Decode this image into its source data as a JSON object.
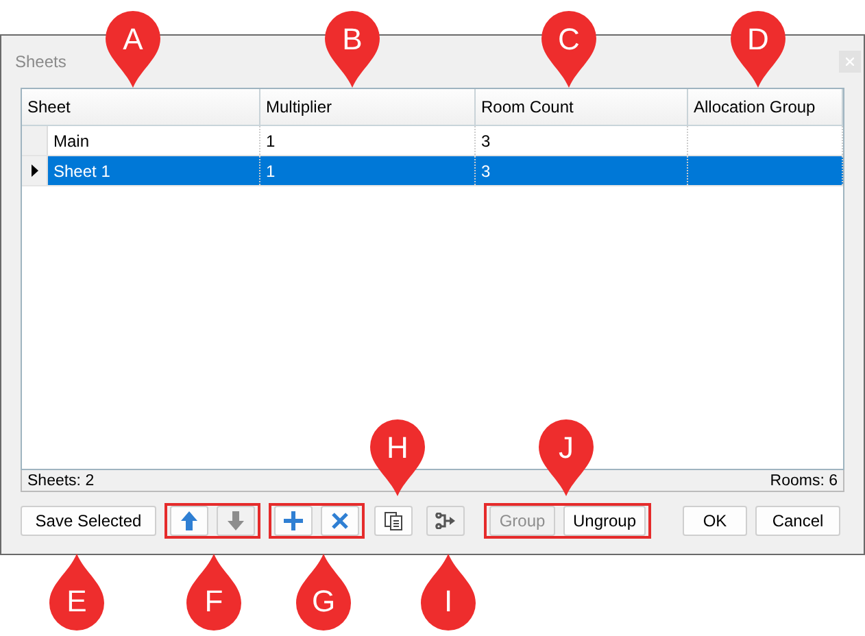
{
  "window": {
    "title": "Sheets"
  },
  "table": {
    "columns": [
      "Sheet",
      "Multiplier",
      "Room Count",
      "Allocation Group"
    ],
    "rows": [
      {
        "cells": [
          "Main",
          "1",
          "3",
          ""
        ],
        "selected": false
      },
      {
        "cells": [
          "Sheet 1",
          "1",
          "3",
          ""
        ],
        "selected": true
      }
    ]
  },
  "status_bar": {
    "left": "Sheets: 2",
    "right": "Rooms: 6"
  },
  "toolbar": [
    {
      "kind": "plain",
      "buttons": [
        {
          "kind": "text",
          "label": "Save Selected",
          "disabled": false
        }
      ]
    },
    {
      "kind": "framed",
      "buttons": [
        {
          "kind": "move-up",
          "disabled": false
        },
        {
          "kind": "move-down",
          "disabled": true
        }
      ]
    },
    {
      "kind": "framed",
      "buttons": [
        {
          "kind": "add",
          "disabled": false
        },
        {
          "kind": "delete",
          "disabled": false
        }
      ]
    },
    {
      "kind": "plain",
      "buttons": [
        {
          "kind": "copy",
          "disabled": false
        }
      ]
    },
    {
      "kind": "plain",
      "buttons": [
        {
          "kind": "branch",
          "disabled": true
        }
      ]
    },
    {
      "kind": "framed",
      "buttons": [
        {
          "kind": "text",
          "label": "Group",
          "disabled": true
        },
        {
          "kind": "text",
          "label": "Ungroup",
          "disabled": false
        }
      ]
    },
    {
      "kind": "plain",
      "buttons": [
        {
          "kind": "text",
          "label": "OK",
          "disabled": false
        }
      ]
    },
    {
      "kind": "plain",
      "buttons": [
        {
          "kind": "text",
          "label": "Cancel",
          "disabled": false
        }
      ]
    }
  ],
  "callouts": [
    {
      "label": "A",
      "kind": "pin"
    },
    {
      "label": "B",
      "kind": "pin"
    },
    {
      "label": "C",
      "kind": "pin"
    },
    {
      "label": "D",
      "kind": "pin"
    },
    {
      "label": "E",
      "kind": "drop"
    },
    {
      "label": "F",
      "kind": "drop"
    },
    {
      "label": "G",
      "kind": "drop"
    },
    {
      "label": "H",
      "kind": "pin"
    },
    {
      "label": "I",
      "kind": "drop"
    },
    {
      "label": "J",
      "kind": "pin"
    }
  ]
}
